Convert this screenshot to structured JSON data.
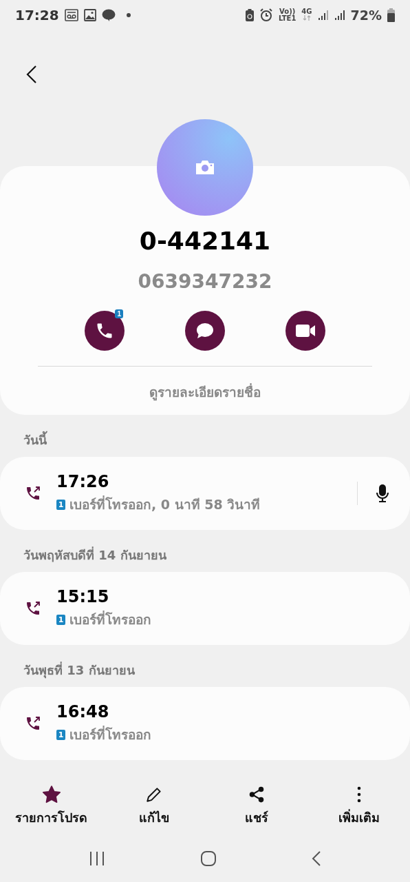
{
  "status_bar": {
    "time": "17:28",
    "volte": "Vo))",
    "lte": "LTE1",
    "network": "4G",
    "battery": "72%"
  },
  "contact": {
    "name": "0-442141",
    "number": "0639347232",
    "call_badge": "1"
  },
  "view_details": "ดูรายละเอียดรายชื่อ",
  "call_groups": [
    {
      "date": "วันนี้",
      "calls": [
        {
          "time": "17:26",
          "sim": "1",
          "detail": "เบอร์ที่โทรออก, 0 นาที 58 วินาที",
          "recording": true
        }
      ]
    },
    {
      "date": "วันพฤหัสบดีที่ 14 กันยายน",
      "calls": [
        {
          "time": "15:15",
          "sim": "1",
          "detail": "เบอร์ที่โทรออก",
          "recording": false
        }
      ]
    },
    {
      "date": "วันพุธที่ 13 กันยายน",
      "calls": [
        {
          "time": "16:48",
          "sim": "1",
          "detail": "เบอร์ที่โทรออก",
          "recording": false
        }
      ]
    }
  ],
  "bottom_actions": [
    {
      "kind": "favorite",
      "label": "รายการโปรด",
      "selected": true
    },
    {
      "kind": "edit",
      "label": "แก้ไข"
    },
    {
      "kind": "share",
      "label": "แชร์"
    },
    {
      "kind": "more",
      "label": "เพิ่มเติม"
    }
  ]
}
